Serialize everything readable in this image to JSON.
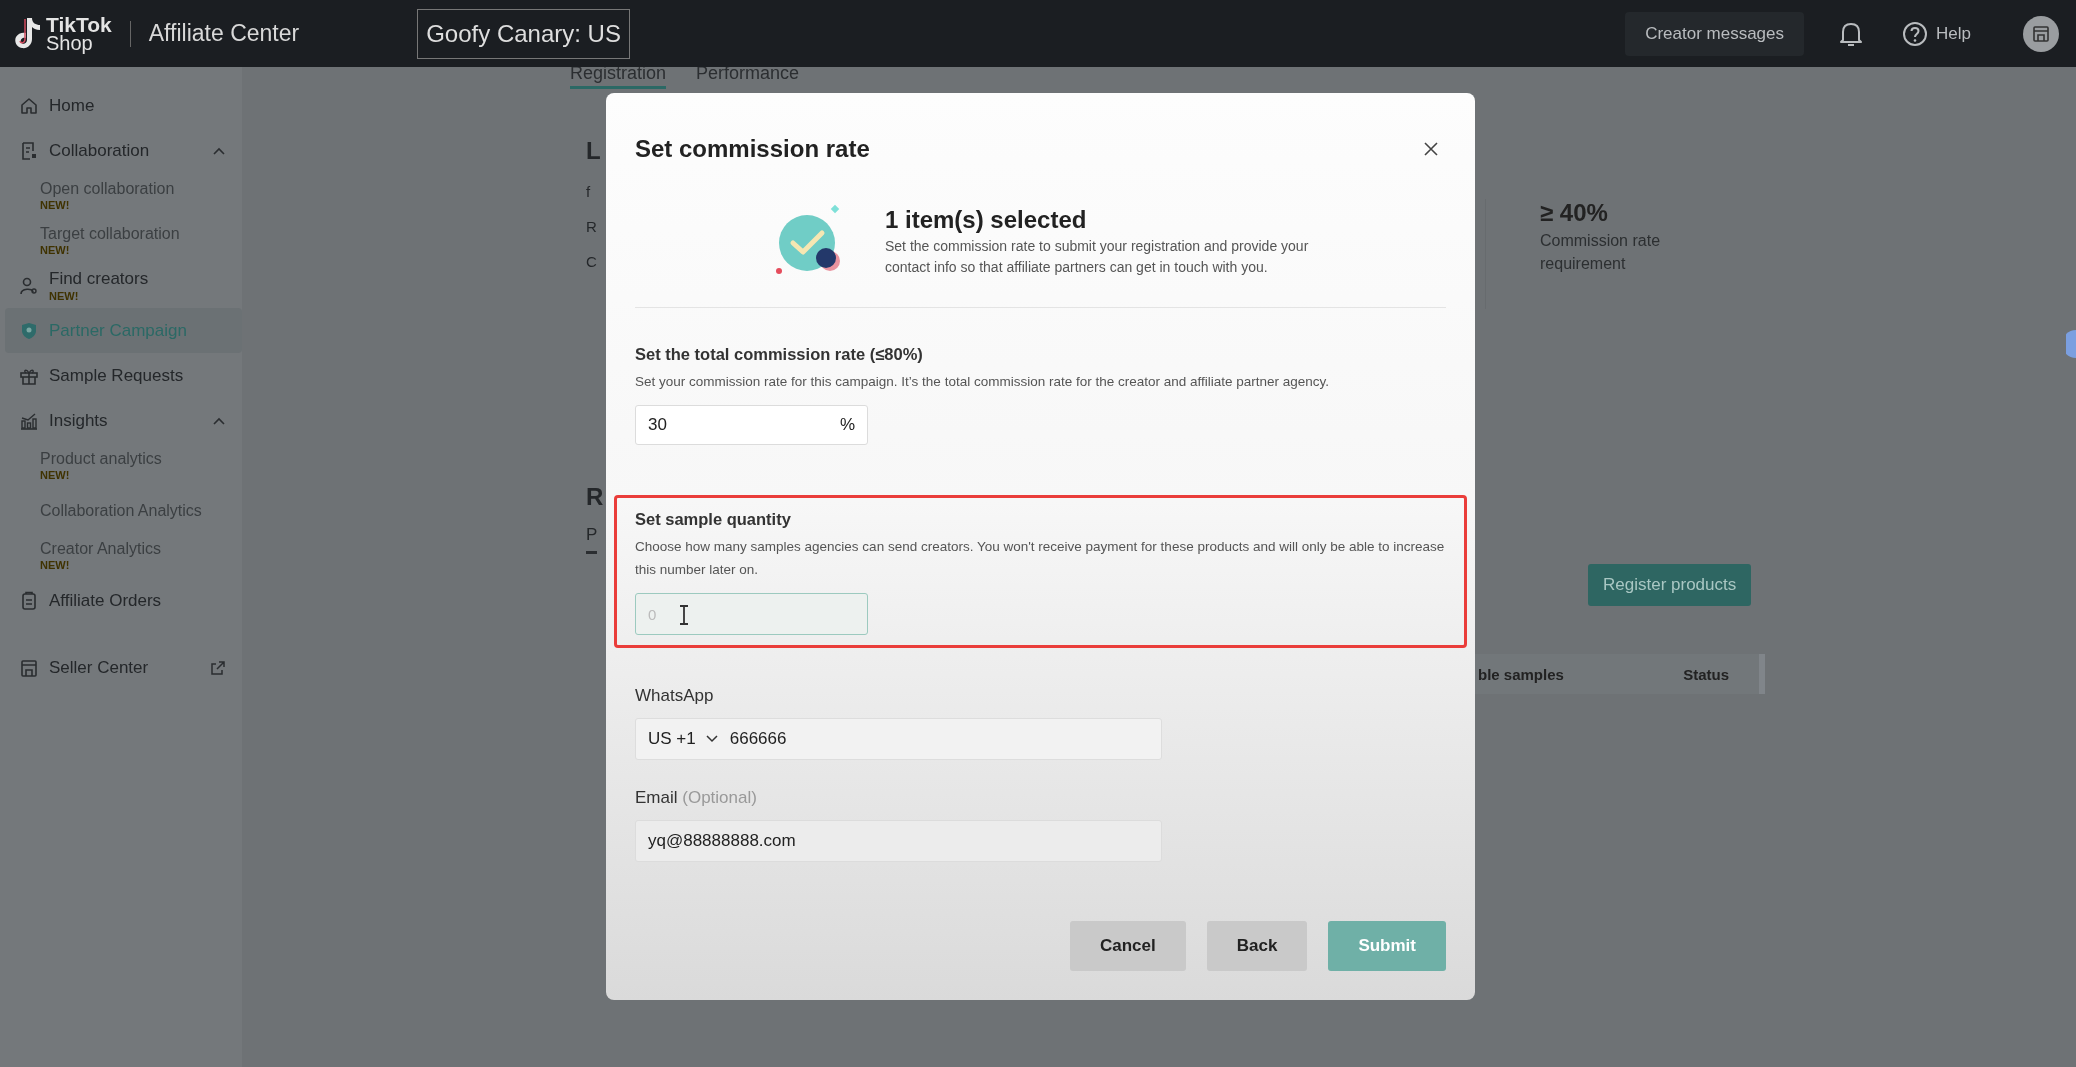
{
  "header": {
    "logo_line_1": "TikTok",
    "logo_line_2": "Shop",
    "app_title": "Affiliate Center",
    "shop_name": "Goofy Canary: US",
    "creator_messages": "Creator messages",
    "help": "Help"
  },
  "sidebar": {
    "items": [
      {
        "label": "Home",
        "kind": "link",
        "selected": false
      },
      {
        "label": "Collaboration",
        "kind": "group",
        "expanded": true,
        "selected": false,
        "children": [
          {
            "label": "Open collaboration",
            "badge": "NEW!",
            "selected": false
          },
          {
            "label": "Target collaboration",
            "badge": "NEW!",
            "selected": false
          }
        ]
      },
      {
        "label": "Find creators",
        "kind": "link",
        "badge": "NEW!",
        "selected": false
      },
      {
        "label": "Partner Campaign",
        "kind": "link",
        "selected": true
      },
      {
        "label": "Sample Requests",
        "kind": "link",
        "selected": false
      },
      {
        "label": "Insights",
        "kind": "group",
        "expanded": true,
        "selected": false,
        "children": [
          {
            "label": "Product analytics",
            "badge": "NEW!",
            "selected": false
          },
          {
            "label": "Collaboration Analytics",
            "selected": false
          },
          {
            "label": "Creator Analytics",
            "badge": "NEW!",
            "selected": false
          }
        ]
      },
      {
        "label": "Affiliate Orders",
        "kind": "link",
        "selected": false
      },
      {
        "label": "Seller Center",
        "kind": "external",
        "selected": false
      }
    ]
  },
  "page": {
    "tabs": [
      {
        "label": "Registration",
        "selected": true
      },
      {
        "label": "Performance",
        "selected": false
      }
    ],
    "section_title": "L",
    "section_lines": [
      "f",
      "R",
      "C"
    ],
    "stat": {
      "value": "≥ 40%",
      "label": "Commission rate requirement"
    },
    "products_title": "R",
    "products_tab": "P",
    "register_button": "Register products",
    "table_columns": [
      "ble samples",
      "Status"
    ]
  },
  "modal": {
    "title": "Set commission rate",
    "summary": {
      "heading": "1 item(s) selected",
      "text": "Set the commission rate to submit your registration and provide your contact info so that affiliate partners can get in touch with you."
    },
    "commission": {
      "label": "Set the total commission rate (≤80%)",
      "help": "Set your commission rate for this campaign. It’s the total commission rate for the creator and affiliate partner agency.",
      "value": "30",
      "suffix": "%"
    },
    "sample_quantity": {
      "label": "Set sample quantity",
      "help": "Choose how many samples agencies can send creators. You won't receive payment for these products and will only be able to increase this number later on.",
      "placeholder": "0",
      "highlighted": true
    },
    "whatsapp": {
      "label": "WhatsApp",
      "country_code": "US +1",
      "value": "666666"
    },
    "email": {
      "label": "Email",
      "optional": "(Optional)",
      "value": "yq@88888888.com"
    },
    "buttons": [
      {
        "label": "Cancel",
        "kind": "secondary",
        "disabled": false
      },
      {
        "label": "Back",
        "kind": "secondary",
        "disabled": false
      },
      {
        "label": "Submit",
        "kind": "primary",
        "disabled": true
      }
    ]
  }
}
